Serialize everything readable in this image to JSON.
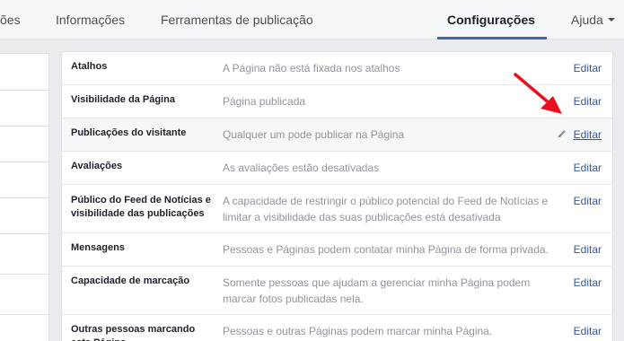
{
  "nav": {
    "items": [
      {
        "label": "ões"
      },
      {
        "label": "Informações"
      },
      {
        "label": "Ferramentas de publicação"
      },
      {
        "label": "Configurações"
      },
      {
        "label": "Ajuda"
      }
    ]
  },
  "settings": {
    "rows": [
      {
        "label": "Atalhos",
        "value": "A Página não está fixada nos atalhos",
        "edit": "Editar"
      },
      {
        "label": "Visibilidade da Página",
        "value": "Página publicada",
        "edit": "Editar"
      },
      {
        "label": "Publicações do visitante",
        "value": "Qualquer um pode publicar na Página",
        "edit": "Editar"
      },
      {
        "label": "Avaliações",
        "value": "As avaliações estão desativadas",
        "edit": "Editar"
      },
      {
        "label": "Público do Feed de Notícias e visibilidade das publicações",
        "value": "A capacidade de restringir o público potencial do Feed de Notícias e limitar a visibilidade das suas publicações está desativada",
        "edit": "Editar"
      },
      {
        "label": "Mensagens",
        "value": "Pessoas e Páginas podem contatar minha Página de forma privada.",
        "edit": "Editar"
      },
      {
        "label": "Capacidade de marcação",
        "value": "Somente pessoas que ajudam a gerenciar minha Página podem marcar fotos publicadas nela.",
        "edit": "Editar"
      },
      {
        "label": "Outras pessoas marcando esta Página",
        "value": "Pessoas e outras Páginas podem marcar minha Página.",
        "edit": "Editar"
      }
    ]
  },
  "colors": {
    "accent": "#4267b2",
    "link": "#365899",
    "arrow": "#e8101f"
  },
  "icons": {
    "edit": "pencil-icon",
    "pointer": "red-arrow-annotation"
  }
}
